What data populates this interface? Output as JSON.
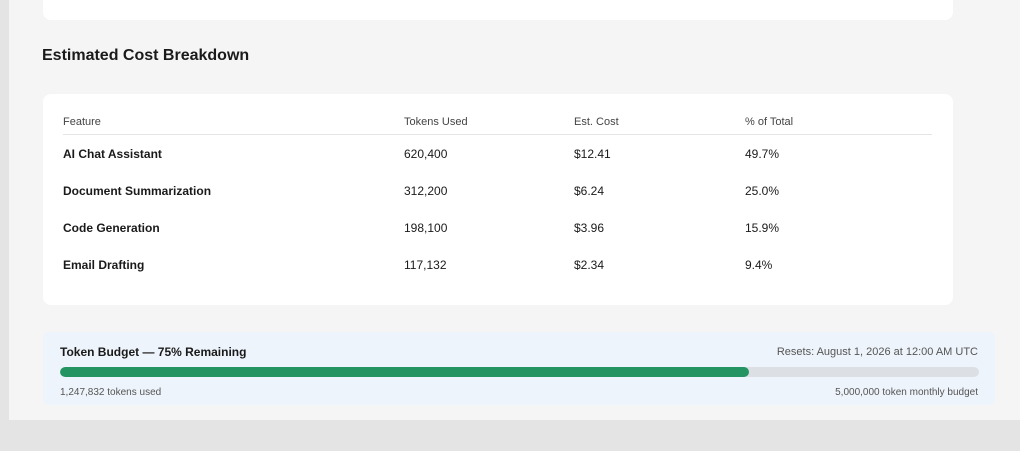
{
  "section": {
    "title": "Estimated Cost Breakdown"
  },
  "table": {
    "headers": [
      "Feature",
      "Tokens Used",
      "Est. Cost",
      "% of Total"
    ],
    "rows": [
      {
        "feature": "AI Chat Assistant",
        "tokens": "620,400",
        "cost": "$12.41",
        "pct": "49.7%"
      },
      {
        "feature": "Document Summarization",
        "tokens": "312,200",
        "cost": "$6.24",
        "pct": "25.0%"
      },
      {
        "feature": "Code Generation",
        "tokens": "198,100",
        "cost": "$3.96",
        "pct": "15.9%"
      },
      {
        "feature": "Email Drafting",
        "tokens": "117,132",
        "cost": "$2.34",
        "pct": "9.4%"
      }
    ]
  },
  "budget": {
    "title": "Token Budget — 75% Remaining",
    "reset": "Resets: August 1, 2026 at 12:00 AM UTC",
    "used_label": "1,247,832 tokens used",
    "budget_label": "5,000,000 token monthly budget",
    "remaining_percent": 75,
    "bar_color": "#249463",
    "track_color": "#dcdfe4"
  }
}
